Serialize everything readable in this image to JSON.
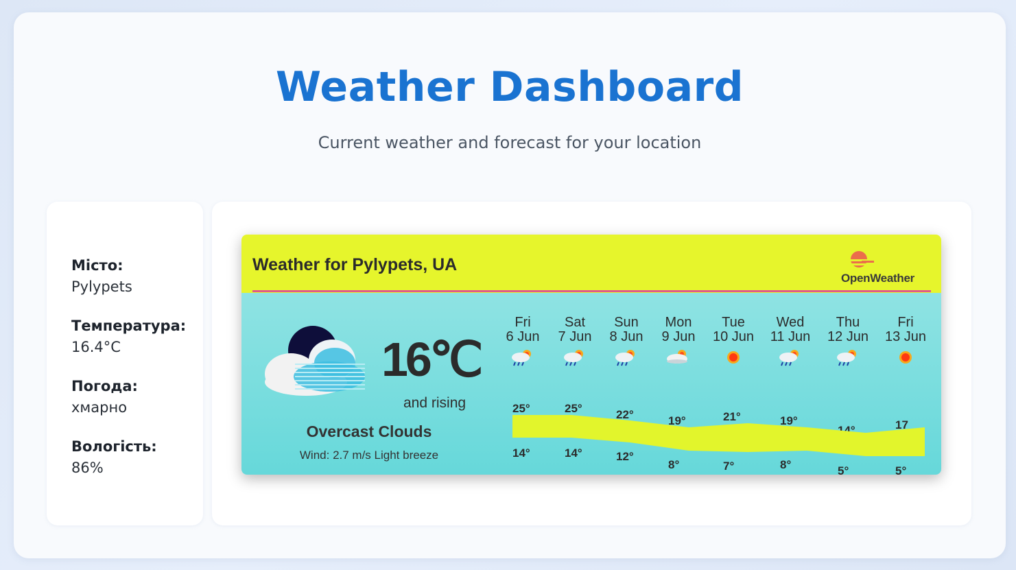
{
  "page": {
    "title": "Weather Dashboard",
    "subtitle": "Current weather and forecast for your location"
  },
  "info": {
    "city_label": "Місто:",
    "city_value": "Pylypets",
    "temp_label": "Температура:",
    "temp_value": "16.4°C",
    "weather_label": "Погода:",
    "weather_value": "хмарно",
    "humidity_label": "Вологість:",
    "humidity_value": "86%"
  },
  "widget": {
    "header_title": "Weather for Pylypets, UA",
    "brand": "OpenWeather",
    "current_temp": "16℃",
    "trend": "and rising",
    "condition": "Overcast Clouds",
    "wind": "Wind: 2.7 m/s Light breeze",
    "days": [
      {
        "dow": "Fri",
        "date": "6 Jun",
        "icon": "rain-sun-icon",
        "hi": "25°",
        "lo": "14°"
      },
      {
        "dow": "Sat",
        "date": "7 Jun",
        "icon": "rain-sun-icon",
        "hi": "25°",
        "lo": "14°"
      },
      {
        "dow": "Sun",
        "date": "8 Jun",
        "icon": "rain-sun-icon",
        "hi": "22°",
        "lo": "12°"
      },
      {
        "dow": "Mon",
        "date": "9 Jun",
        "icon": "cloud-sun-icon",
        "hi": "19°",
        "lo": "8°"
      },
      {
        "dow": "Tue",
        "date": "10 Jun",
        "icon": "sun-icon",
        "hi": "21°",
        "lo": "7°"
      },
      {
        "dow": "Wed",
        "date": "11 Jun",
        "icon": "rain-sun-icon",
        "hi": "19°",
        "lo": "8°"
      },
      {
        "dow": "Thu",
        "date": "12 Jun",
        "icon": "rain-sun-icon",
        "hi": "14°",
        "lo": "5°"
      },
      {
        "dow": "Fri",
        "date": "13 Jun",
        "icon": "sun-icon",
        "hi": "17",
        "lo": "5°"
      }
    ]
  },
  "colors": {
    "accent": "#1a73d1",
    "widget_header": "#e6f52c",
    "widget_body": "#7addde",
    "temp_band": "#e2f52c",
    "header_line": "#e05a8a"
  }
}
